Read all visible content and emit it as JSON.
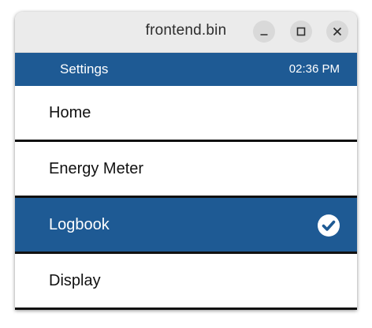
{
  "window": {
    "title": "frontend.bin"
  },
  "header": {
    "title": "Settings",
    "time": "02:36 PM"
  },
  "menu": {
    "items": [
      {
        "label": "Home",
        "selected": false
      },
      {
        "label": "Energy Meter",
        "selected": false
      },
      {
        "label": "Logbook",
        "selected": true
      },
      {
        "label": "Display",
        "selected": false
      }
    ]
  },
  "colors": {
    "accent": "#1e5a94",
    "divider": "#111111",
    "titlebar": "#ebebeb"
  },
  "icons": {
    "minimize": "minimize-icon",
    "maximize": "maximize-icon",
    "close": "close-icon",
    "selected": "check-circle-icon"
  }
}
